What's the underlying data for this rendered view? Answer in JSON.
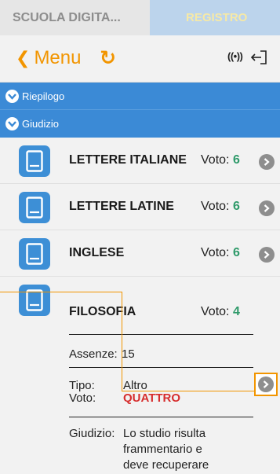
{
  "tabs": {
    "left": "SCUOLA DIGITA...",
    "right": "REGISTRO"
  },
  "menubar": {
    "back_label": "Menu",
    "chevron": "❮",
    "refresh_icon": "↻",
    "wifi_icon": "((•))",
    "exit_icon": "exit-icon"
  },
  "sections": [
    {
      "label": "Riepilogo"
    },
    {
      "label": "Giudizio"
    }
  ],
  "rows": [
    {
      "subject": "LETTERE ITALIANE",
      "voto_label": "Voto:",
      "voto": "6"
    },
    {
      "subject": "LETTERE LATINE",
      "voto_label": "Voto:",
      "voto": "6"
    },
    {
      "subject": "INGLESE",
      "voto_label": "Voto:",
      "voto": "6"
    },
    {
      "subject": "FILOSOFIA",
      "voto_label": "Voto:",
      "voto": "4"
    }
  ],
  "detail": {
    "assenze_label": "Assenze:",
    "assenze_value": "15",
    "tipo_label": "Tipo:",
    "tipo_value": "Altro",
    "voto_label": "Voto:",
    "voto_value": "QUATTRO",
    "giudizio_label": "Giudizio:",
    "giudizio_lines": [
      "Lo studio risulta",
      "frammentario e",
      "deve recuperare"
    ]
  },
  "colors": {
    "accent_orange": "#f29500",
    "section_blue": "#3b8ad6",
    "voto_green": "#2f9a6a",
    "voto_red": "#d62d2d"
  }
}
